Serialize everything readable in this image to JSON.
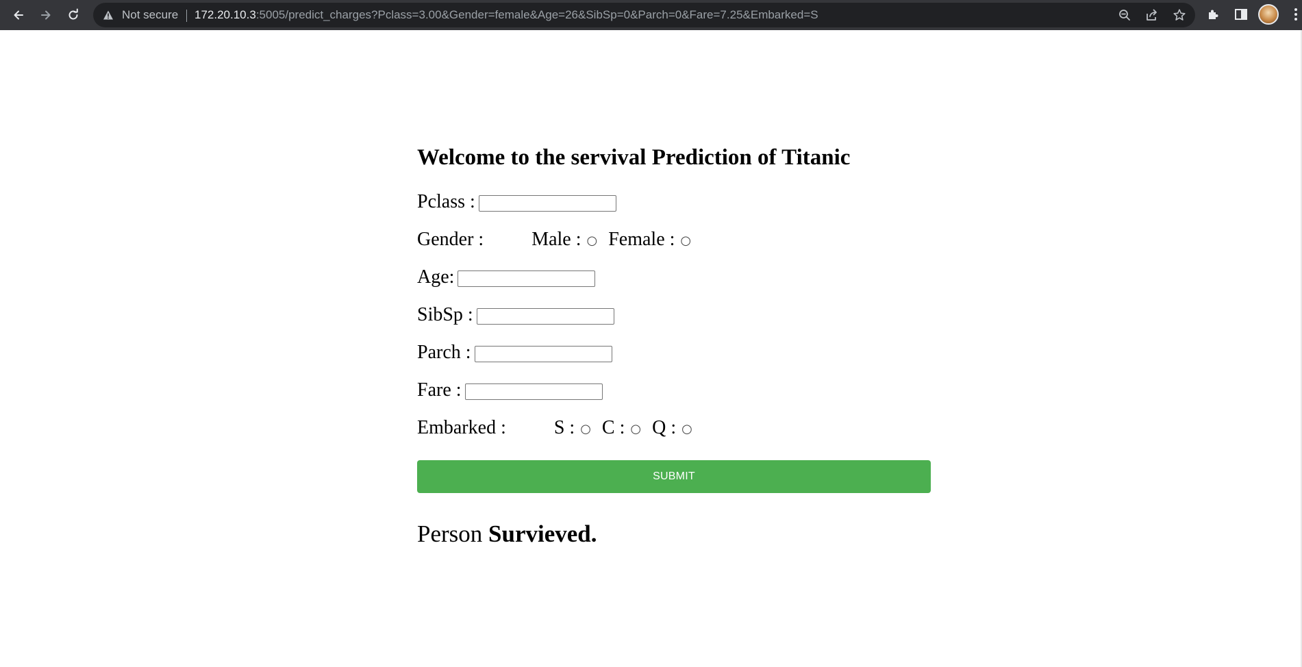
{
  "browser": {
    "security_label": "Not secure",
    "url_host": "172.20.10.3",
    "url_rest": ":5005/predict_charges?Pclass=3.00&Gender=female&Age=26&SibSp=0&Parch=0&Fare=7.25&Embarked=S",
    "icons": [
      "back-arrow-icon",
      "forward-arrow-icon",
      "reload-icon",
      "warning-icon",
      "zoom-icon",
      "share-icon",
      "star-icon",
      "extensions-icon",
      "side-panel-icon",
      "profile-avatar",
      "menu-kebab-icon"
    ]
  },
  "page": {
    "heading": "Welcome to the servival Prediction of Titanic",
    "form": {
      "pclass_label": "Pclass :",
      "gender_label": "Gender :",
      "male_label": "Male :",
      "female_label": "Female :",
      "age_label": "Age:",
      "sibsp_label": "SibSp :",
      "parch_label": "Parch :",
      "fare_label": "Fare :",
      "embarked_label": "Embarked :",
      "embarked_s_label": "S :",
      "embarked_c_label": "C :",
      "embarked_q_label": "Q :",
      "radio_glyph": "○",
      "submit_label": "SUBMIT"
    },
    "result": {
      "prefix": "Person",
      "outcome": "Survieved."
    },
    "colors": {
      "submit_bg": "#4caf50",
      "toolbar_bg": "#35363a",
      "omnibox_bg": "#202124"
    }
  }
}
